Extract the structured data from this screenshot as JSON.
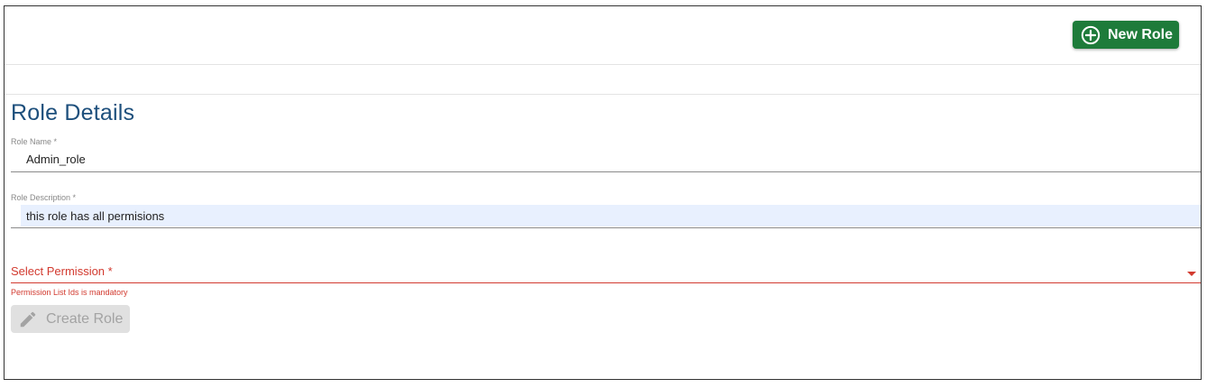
{
  "toolbar": {
    "new_role_label": "New Role",
    "new_role_icon": "plus-circle-icon"
  },
  "role_details": {
    "title": "Role Details",
    "role_name": {
      "label": "Role Name *",
      "value": "Admin_role"
    },
    "role_description": {
      "label": "Role Description *",
      "value": "this role has all permisions"
    },
    "permission": {
      "label": "Select Permission *",
      "error": "Permission List Ids is mandatory"
    },
    "create_button": {
      "label": "Create Role",
      "icon": "pencil-icon",
      "disabled": true
    }
  },
  "colors": {
    "primary_green": "#1e7b3a",
    "title_blue": "#1d4f7c",
    "error_red": "#d23a2f",
    "autofill_bg": "#e8f0fe",
    "disabled_bg": "#e0e0e0"
  }
}
